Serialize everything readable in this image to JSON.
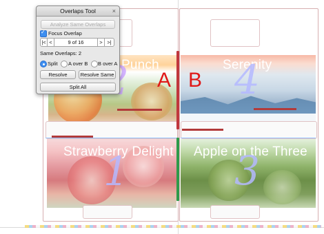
{
  "palette": {
    "title": "Overlaps Tool",
    "close_glyph": "×",
    "analyze_button": "Analyze Same Overlaps",
    "focus_overlap_label": "Focus Overlap",
    "focus_overlap_checked": true,
    "nav_first": "|<",
    "nav_prev": "<",
    "nav_position": "9 of 16",
    "nav_next": ">",
    "nav_last": ">|",
    "same_overlaps_text": "Same Overlaps: 2",
    "mode_options": [
      "Split",
      "A over B",
      "B over A"
    ],
    "mode_selected": "Split",
    "resolve_button": "Resolve",
    "resolve_same_button": "Resolve Same",
    "split_all_button": "Split All"
  },
  "artboard": {
    "labels": {
      "a": "A",
      "b": "B"
    },
    "panels": [
      {
        "title": "Punch",
        "number": "2"
      },
      {
        "title": "Serenity",
        "number": "4"
      },
      {
        "title": "Strawberry Delight",
        "number": "1"
      },
      {
        "title": "Apple on the Three",
        "number": "3"
      }
    ],
    "overlap_colors": {
      "selected": "#c0373d",
      "other": "#2e9a4a"
    }
  }
}
